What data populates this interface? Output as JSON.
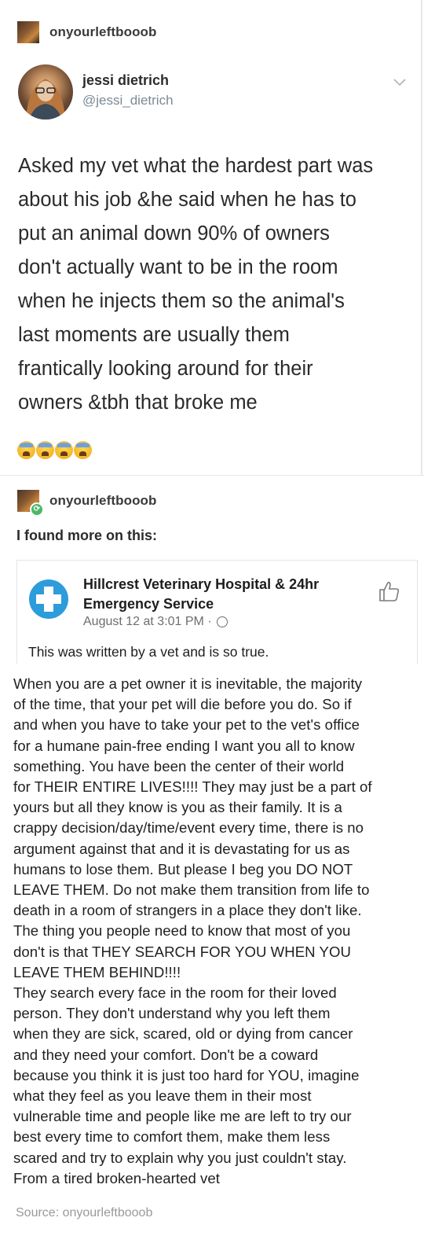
{
  "post": {
    "username": "onyourleftbooob"
  },
  "tweet": {
    "name": "jessi dietrich",
    "handle": "@jessi_dietrich",
    "lines": [
      "Asked my vet what the hardest part was",
      "about his job &he said when he has to",
      "put an animal down 90% of owners",
      "don't actually want to be in the room",
      "when he injects them so the animal's",
      "last moments are usually them",
      "frantically looking around for their",
      "owners &tbh that broke me"
    ],
    "emoji_count": 4
  },
  "reblog": {
    "username": "onyourleftbooob",
    "comment": "I found more on this:"
  },
  "facebook": {
    "page_name_line1": "Hillcrest Veterinary Hospital & 24hr",
    "page_name_line2": "Emergency Service",
    "date": "August 12 at 3:01 PM ·",
    "caption": "This was written by a vet and is so true.",
    "brand_color": "#2d9cdb"
  },
  "vet_post": {
    "lines": [
      "When you are a pet owner it is inevitable, the majority",
      "of the time, that your pet will die before you do. So if",
      "and when you have to take your pet to the vet's office",
      "for a humane pain-free ending I want you all to know",
      "something. You have been the center of their world",
      "for THEIR ENTIRE LIVES!!!! They may just be a part of",
      "yours but all they know is you as their family. It is a",
      "crappy decision/day/time/event every time, there is no",
      "argument against that and it is devastating for us as",
      "humans to lose them. But please I beg you DO NOT",
      "LEAVE THEM. Do not make them transition from life to",
      "death in a room of strangers in a place they don't like.",
      "The thing you people need to know that most of you",
      "don't is that THEY SEARCH FOR YOU WHEN YOU",
      "LEAVE THEM BEHIND!!!!",
      "They search every face in the room for their loved",
      "person. They don't understand why you left them",
      "when they are sick, scared, old or dying from cancer",
      "and they need your comfort. Don't be a coward",
      "because you think it is just too hard for YOU, imagine",
      "what they feel as you leave them in their most",
      "vulnerable time and people like me are left to try our",
      "best every time to comfort them, make them less",
      "scared and try to explain why you just couldn't stay.",
      "From a tired broken-hearted vet"
    ]
  },
  "source": "Source: onyourleftbooob",
  "colors": {
    "reblog_badge": "#4ab866",
    "handle": "#7b8a96"
  }
}
